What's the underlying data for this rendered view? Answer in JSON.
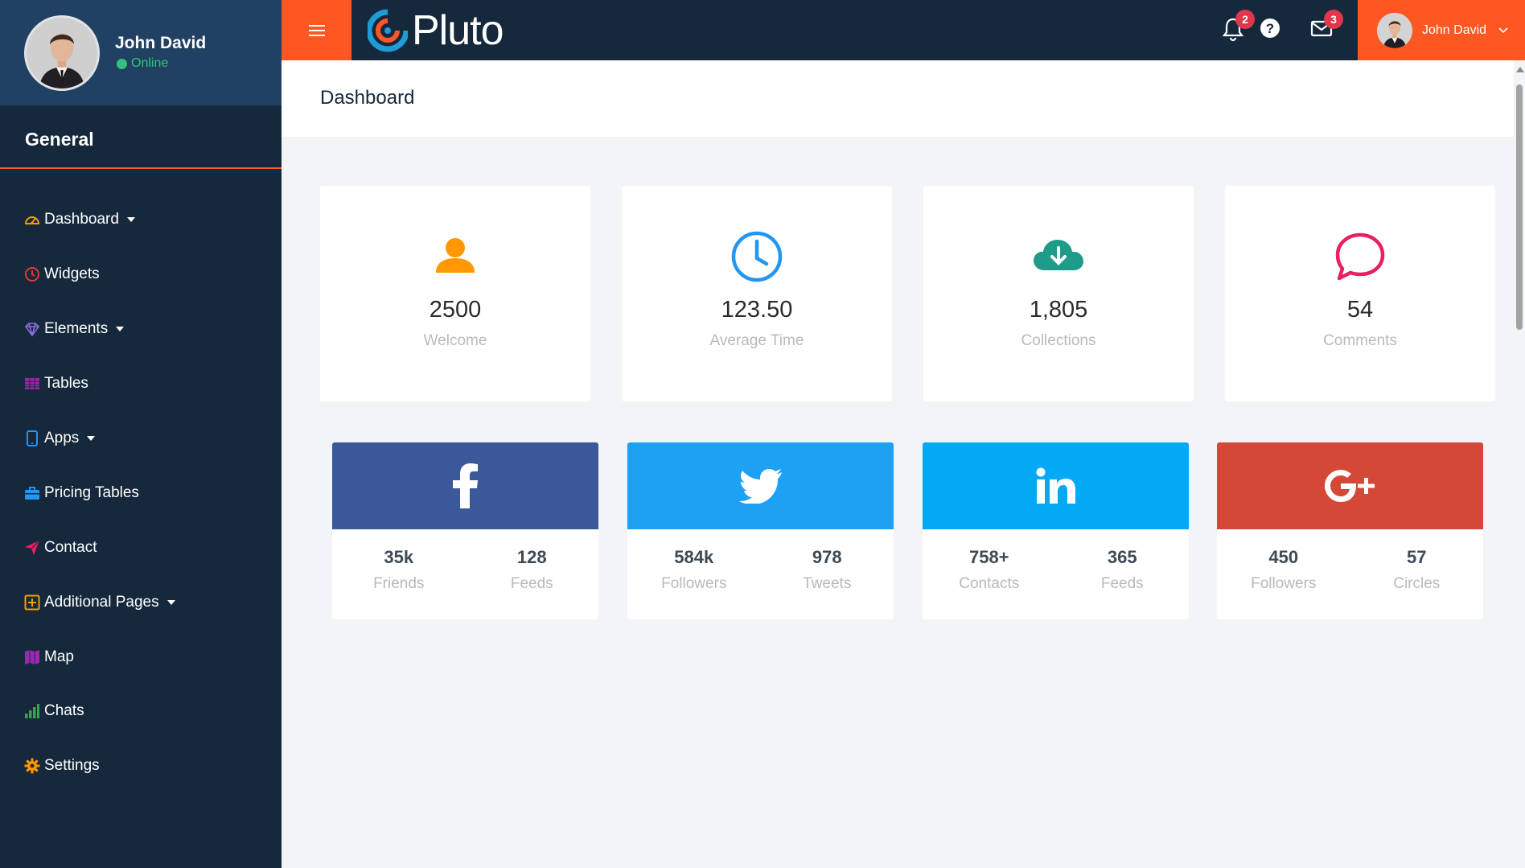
{
  "sidebar": {
    "profile": {
      "name": "John David",
      "status": "Online"
    },
    "section_title": "General",
    "items": [
      {
        "label": "Dashboard",
        "icon": "dashboard-icon",
        "color": "#ff9800",
        "has_caret": true
      },
      {
        "label": "Widgets",
        "icon": "clock-icon",
        "color": "#e53935",
        "has_caret": false
      },
      {
        "label": "Elements",
        "icon": "diamond-icon",
        "color": "#8e44ad",
        "has_caret": true
      },
      {
        "label": "Tables",
        "icon": "table-icon",
        "color": "#9c27b0",
        "has_caret": false
      },
      {
        "label": "Apps",
        "icon": "tablet-icon",
        "color": "#2196f3",
        "has_caret": true
      },
      {
        "label": "Pricing Tables",
        "icon": "briefcase-icon",
        "color": "#2196f3",
        "has_caret": false
      },
      {
        "label": "Contact",
        "icon": "paper-plane-icon",
        "color": "#e91e63",
        "has_caret": false
      },
      {
        "label": "Additional Pages",
        "icon": "plus-square-icon",
        "color": "#ff9800",
        "has_caret": true
      },
      {
        "label": "Map",
        "icon": "map-icon",
        "color": "#9c27b0",
        "has_caret": false
      },
      {
        "label": "Chats",
        "icon": "bar-chart-icon",
        "color": "#2ea84f",
        "has_caret": false
      },
      {
        "label": "Settings",
        "icon": "gear-icon",
        "color": "#ff9800",
        "has_caret": false
      }
    ]
  },
  "topbar": {
    "logo_text": "Pluto",
    "notifications_count": "2",
    "messages_count": "3",
    "user_name": "John David"
  },
  "page": {
    "title": "Dashboard"
  },
  "stats": [
    {
      "value": "2500",
      "label": "Welcome",
      "icon": "user-icon",
      "color": "#ff9800"
    },
    {
      "value": "123.50",
      "label": "Average Time",
      "icon": "clock-icon",
      "color": "#2196f3"
    },
    {
      "value": "1,805",
      "label": "Collections",
      "icon": "cloud-download-icon",
      "color": "#1e9c89"
    },
    {
      "value": "54",
      "label": "Comments",
      "icon": "comment-icon",
      "color": "#e91e63"
    }
  ],
  "social": [
    {
      "network": "facebook",
      "icon": "facebook-icon",
      "color": "#3b5998",
      "stat1": {
        "value": "35k",
        "label": "Friends"
      },
      "stat2": {
        "value": "128",
        "label": "Feeds"
      }
    },
    {
      "network": "twitter",
      "icon": "twitter-icon",
      "color": "#1da1f2",
      "stat1": {
        "value": "584k",
        "label": "Followers"
      },
      "stat2": {
        "value": "978",
        "label": "Tweets"
      }
    },
    {
      "network": "linkedin",
      "icon": "linkedin-icon",
      "color": "#03a9f4",
      "stat1": {
        "value": "758+",
        "label": "Contacts"
      },
      "stat2": {
        "value": "365",
        "label": "Feeds"
      }
    },
    {
      "network": "google-plus",
      "icon": "google-plus-icon",
      "color": "#d34836",
      "stat1": {
        "value": "450",
        "label": "Followers"
      },
      "stat2": {
        "value": "57",
        "label": "Circles"
      }
    }
  ]
}
